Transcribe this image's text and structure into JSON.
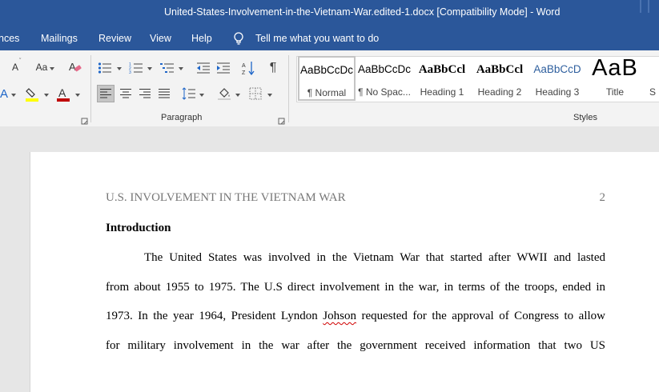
{
  "window": {
    "title": "United-States-Involvement-in-the-Vietnam-War.edited-1.docx [Compatibility Mode]  -  Word"
  },
  "tabs": [
    "nces",
    "Mailings",
    "Review",
    "View",
    "Help"
  ],
  "tell_me": "Tell me what you want to do",
  "ribbon": {
    "font_change_case": "Aa",
    "font_color": "#c00000",
    "highlight_color": "#ffff00",
    "paragraph_label": "Paragraph",
    "styles_label": "Styles",
    "styles": [
      {
        "sample": "AaBbCcDc",
        "name": "¶ Normal",
        "selected": true
      },
      {
        "sample": "AaBbCcDc",
        "name": "¶ No Spac...",
        "selected": false
      },
      {
        "sample": "AaBbCcl",
        "name": "Heading 1",
        "selected": false
      },
      {
        "sample": "AaBbCcl",
        "name": "Heading 2",
        "selected": false
      },
      {
        "sample": "AaBbCcD",
        "name": "Heading 3",
        "selected": false
      },
      {
        "sample": "AaB",
        "name": "Title",
        "selected": false
      },
      {
        "sample": "",
        "name": "S",
        "selected": false
      }
    ]
  },
  "document": {
    "running_head": "U.S. INVOLVEMENT IN THE VIETNAM WAR",
    "page_number": "2",
    "heading": "Introduction",
    "lines": [
      "The United States was involved in the Vietnam War that started after WWII and lasted",
      "from about 1955 to 1975. The U.S direct involvement in the war, in terms of the troops, ended in",
      {
        "before": "1973. In the year 1964, President Lyndon ",
        "misspelled": "Johson",
        "after": " requested for the approval of Congress to allow"
      },
      "for military involvement in the war after the government received information that two US"
    ]
  }
}
